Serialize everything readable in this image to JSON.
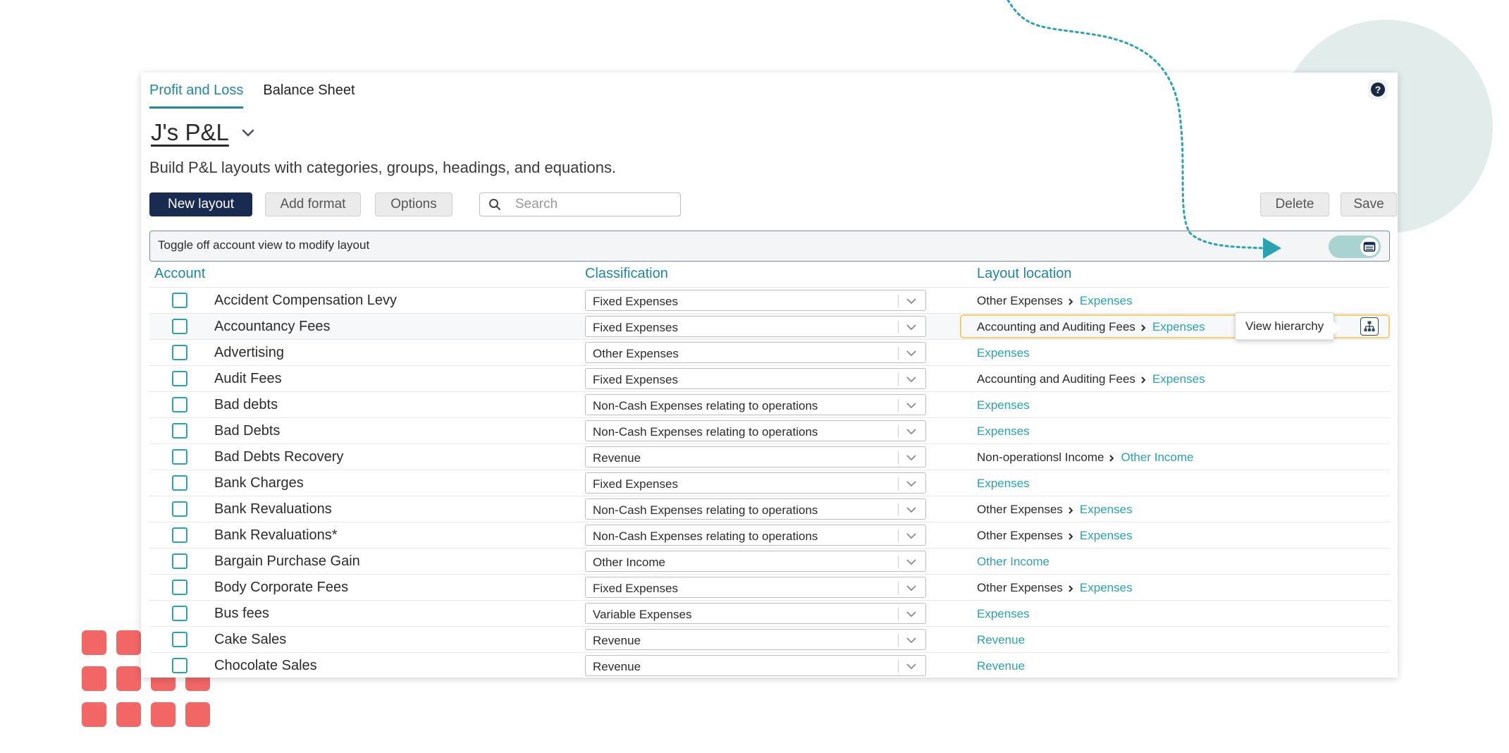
{
  "tabs": [
    {
      "label": "Profit and Loss",
      "active": true
    },
    {
      "label": "Balance Sheet",
      "active": false
    }
  ],
  "help": {
    "label": "?"
  },
  "layout": {
    "title": "J's P&L",
    "subtitle": "Build P&L layouts with categories, groups, headings, and equations."
  },
  "toolbar": {
    "new_layout": "New layout",
    "add_format": "Add format",
    "options": "Options",
    "search_placeholder": "Search",
    "delete": "Delete",
    "save": "Save"
  },
  "toggle_bar": {
    "label": "Toggle off account view to modify layout",
    "on": true
  },
  "table": {
    "headers": {
      "account": "Account",
      "classification": "Classification",
      "location": "Layout location"
    },
    "rows": [
      {
        "account": "Accident Compensation Levy",
        "classification": "Fixed Expenses",
        "location_prefix": "Other Expenses",
        "location_link": "Expenses"
      },
      {
        "account": "Accountancy Fees",
        "classification": "Fixed Expenses",
        "location_prefix": "Accounting and Auditing Fees",
        "location_link": "Expenses",
        "highlighted": true
      },
      {
        "account": "Advertising",
        "classification": "Other Expenses",
        "location_prefix": "",
        "location_link": "Expenses"
      },
      {
        "account": "Audit Fees",
        "classification": "Fixed Expenses",
        "location_prefix": "Accounting and Auditing Fees",
        "location_link": "Expenses"
      },
      {
        "account": "Bad debts",
        "classification": "Non-Cash Expenses relating to operations",
        "location_prefix": "",
        "location_link": "Expenses"
      },
      {
        "account": "Bad Debts",
        "classification": "Non-Cash Expenses relating to operations",
        "location_prefix": "",
        "location_link": "Expenses"
      },
      {
        "account": "Bad Debts Recovery",
        "classification": "Revenue",
        "location_prefix": "Non-operationsl Income",
        "location_link": "Other Income"
      },
      {
        "account": "Bank Charges",
        "classification": "Fixed Expenses",
        "location_prefix": "",
        "location_link": "Expenses"
      },
      {
        "account": "Bank Revaluations",
        "classification": "Non-Cash Expenses relating to operations",
        "location_prefix": "Other Expenses",
        "location_link": "Expenses"
      },
      {
        "account": "Bank Revaluations*",
        "classification": "Non-Cash Expenses relating to operations",
        "location_prefix": "Other Expenses",
        "location_link": "Expenses"
      },
      {
        "account": "Bargain Purchase Gain",
        "classification": "Other Income",
        "location_prefix": "",
        "location_link": "Other Income"
      },
      {
        "account": "Body Corporate Fees",
        "classification": "Fixed Expenses",
        "location_prefix": "Other Expenses",
        "location_link": "Expenses"
      },
      {
        "account": "Bus fees",
        "classification": "Variable Expenses",
        "location_prefix": "",
        "location_link": "Expenses"
      },
      {
        "account": "Cake Sales",
        "classification": "Revenue",
        "location_prefix": "",
        "location_link": "Revenue"
      },
      {
        "account": "Chocolate Sales",
        "classification": "Revenue",
        "location_prefix": "",
        "location_link": "Revenue"
      }
    ]
  },
  "tooltip": {
    "label": "View hierarchy"
  },
  "icons": {
    "title_chevron": "chevron-down-icon",
    "search": "search-icon",
    "toggle_knob": "table-view-icon",
    "select_chevron": "chevron-down-icon",
    "location_separator": "chevron-right-icon",
    "hierarchy": "hierarchy-icon",
    "help": "help-icon"
  },
  "colors": {
    "accent": "#1f86a3",
    "link": "#2aa2b0",
    "primary_button": "#1a2b52",
    "highlight_border": "#f4cf6c",
    "toggle_track": "#a8d3d1",
    "decor_circle": "#e1eceb",
    "decor_dots": "#f26666"
  }
}
